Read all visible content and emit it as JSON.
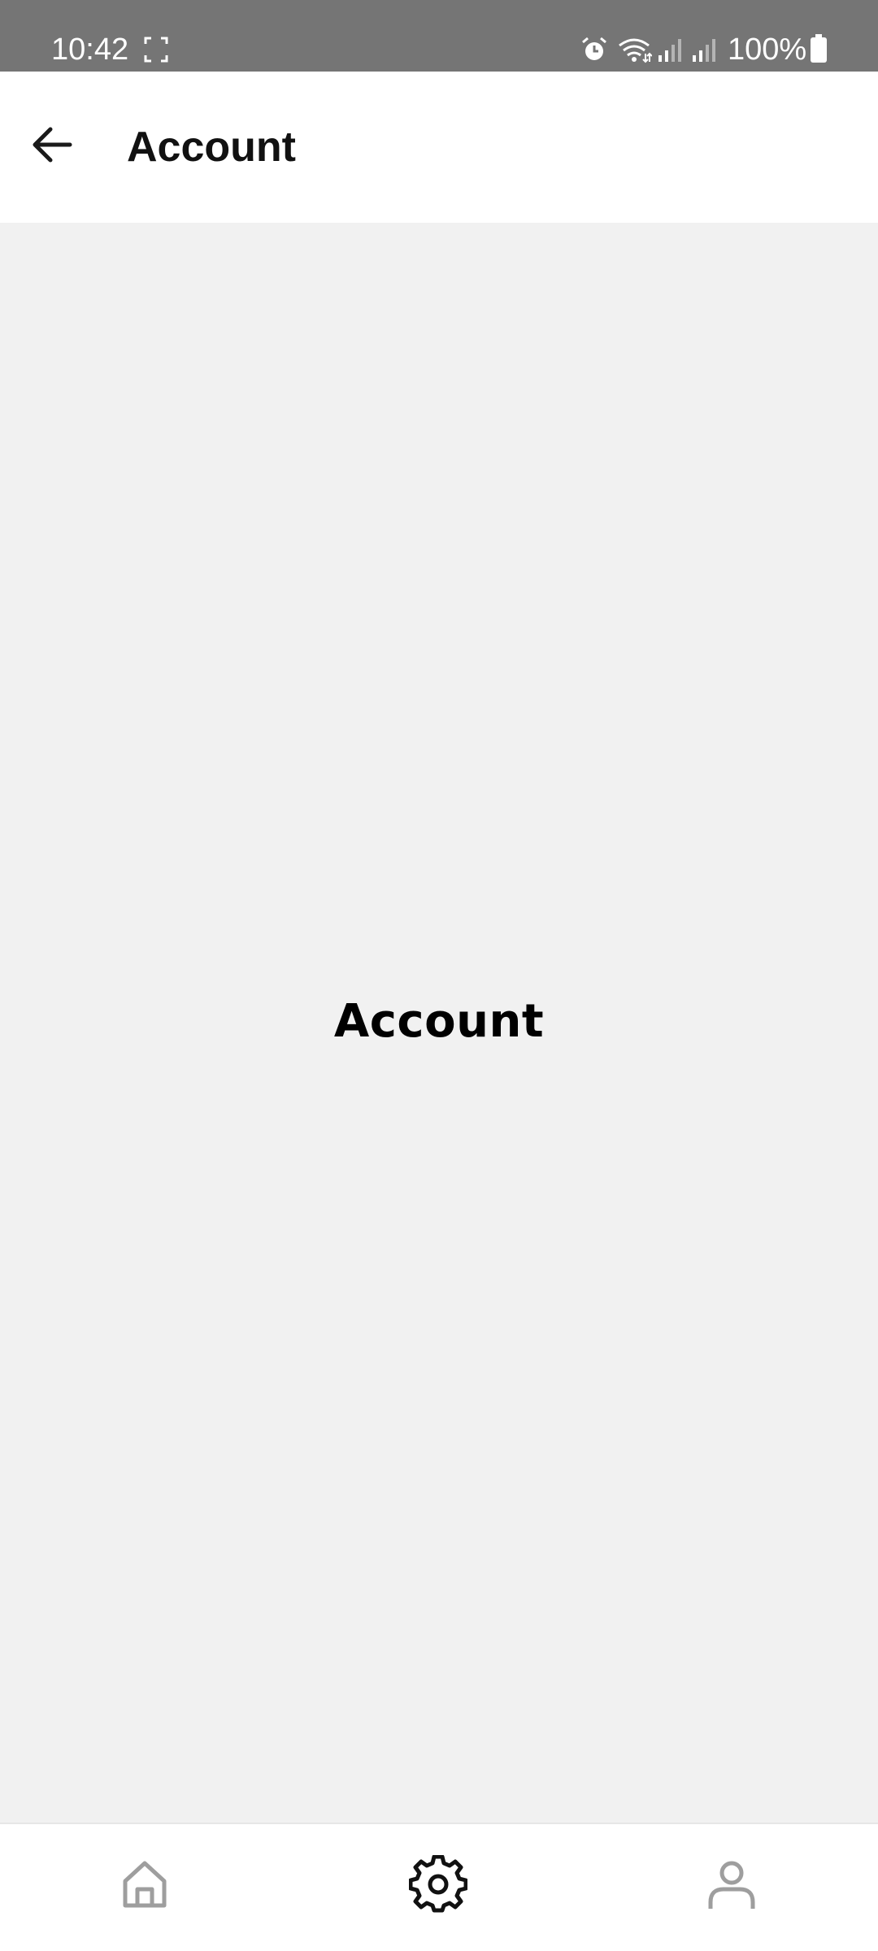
{
  "status_bar": {
    "time": "10:42",
    "battery": "100%",
    "icons": [
      "screenshot-icon",
      "alarm-icon",
      "wifi-icon",
      "signal-icon",
      "signal-icon",
      "battery-icon"
    ]
  },
  "app_bar": {
    "title": "Account",
    "back_icon": "arrow-left-icon"
  },
  "content": {
    "heading": "Account"
  },
  "bottom_nav": {
    "items": [
      {
        "icon": "home-icon",
        "active": false
      },
      {
        "icon": "gear-icon",
        "active": true
      },
      {
        "icon": "person-icon",
        "active": false
      }
    ],
    "active_color": "#111111",
    "inactive_color": "#9e9e9e"
  },
  "colors": {
    "status_bar": "#757575",
    "background": "#f1f1f1",
    "surface": "#ffffff"
  }
}
